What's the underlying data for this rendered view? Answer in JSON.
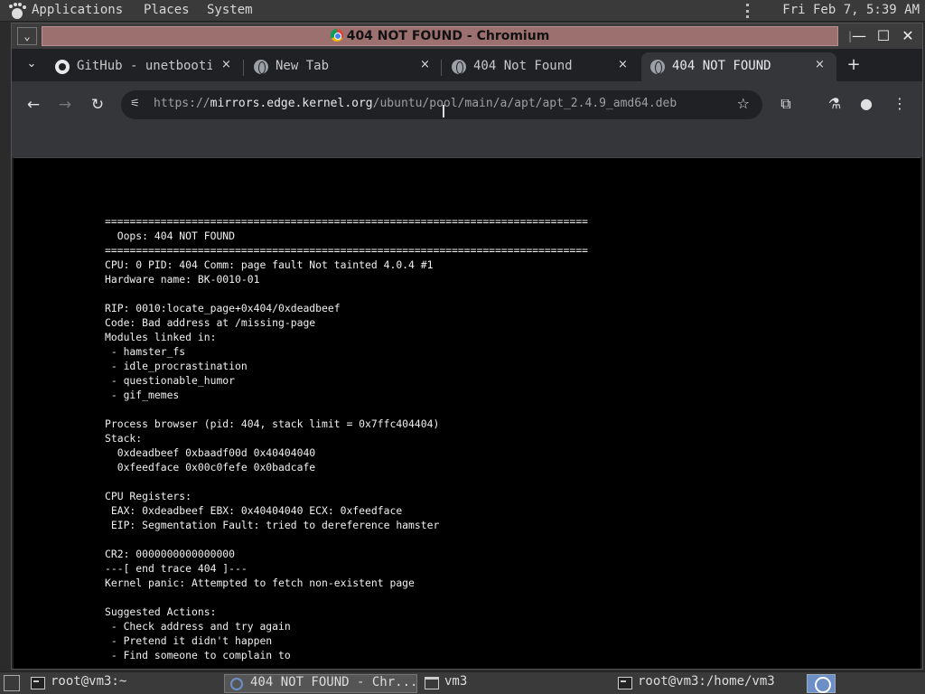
{
  "top_panel": {
    "menus": [
      "Applications",
      "Places",
      "System"
    ],
    "clock": "Fri Feb  7,  5:39 AM"
  },
  "window": {
    "title": "404 NOT FOUND - Chromium"
  },
  "tabs": [
    {
      "label": "GitHub - unetbootin",
      "icon": "github-icon",
      "close": "×"
    },
    {
      "label": "New Tab",
      "icon": "globe-icon",
      "close": "×"
    },
    {
      "label": "404 Not Found",
      "icon": "globe-icon",
      "close": "×"
    },
    {
      "label": "404 NOT FOUND",
      "icon": "globe-icon",
      "close": "×",
      "active": true
    }
  ],
  "new_tab_label": "+",
  "address_bar": {
    "url_prefix": "https://",
    "url_host": "mirrors.edge.kernel.org",
    "url_path": "/ubuntu/pool/main/a/apt/apt_2.4.9_amd64.deb"
  },
  "page": {
    "lines": [
      "==============================================================================",
      "  Oops: 404 NOT FOUND",
      "==============================================================================",
      "CPU: 0 PID: 404 Comm: page fault Not tainted 4.0.4 #1",
      "Hardware name: BK-0010-01",
      "",
      "RIP: 0010:locate_page+0x404/0xdeadbeef",
      "Code: Bad address at /missing-page",
      "Modules linked in:",
      " - hamster_fs",
      " - idle_procrastination",
      " - questionable_humor",
      " - gif_memes",
      "",
      "Process browser (pid: 404, stack limit = 0x7ffc404404)",
      "Stack:",
      "  0xdeadbeef 0xbaadf00d 0x40404040",
      "  0xfeedface 0x00c0fefe 0x0badcafe",
      "",
      "CPU Registers:",
      " EAX: 0xdeadbeef EBX: 0x40404040 ECX: 0xfeedface",
      " EIP: Segmentation Fault: tried to dereference hamster",
      "",
      "CR2: 0000000000000000",
      "---[ end trace 404 ]---",
      "Kernel panic: Attempted to fetch non-existent page",
      "",
      "Suggested Actions:",
      " - Check address and try again",
      " - Pretend it didn't happen",
      " - Find someone to complain to"
    ]
  },
  "taskbar": {
    "items": [
      {
        "label": "root@vm3:~",
        "icon": "terminal-icon"
      },
      {
        "label": "404 NOT FOUND - Chr...",
        "icon": "chromium-icon",
        "active": true
      },
      {
        "label": "vm3",
        "icon": "home-folder-icon"
      },
      {
        "label": "root@vm3:/home/vm3",
        "icon": "terminal-icon"
      }
    ]
  }
}
